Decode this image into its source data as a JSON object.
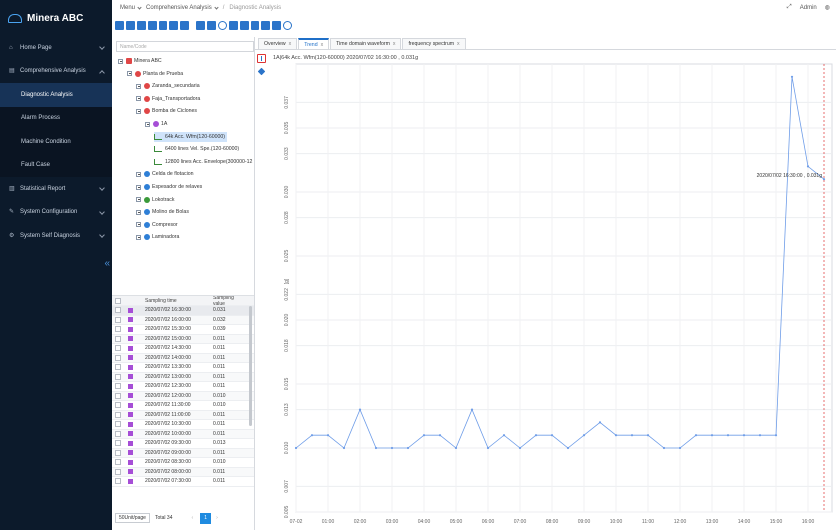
{
  "app": {
    "title": "Minera ABC"
  },
  "sidebar": {
    "items": [
      {
        "label": "Home Page",
        "icon": "home-icon",
        "chevron": "down"
      },
      {
        "label": "Comprehensive Analysis",
        "icon": "chart-icon",
        "chevron": "up"
      },
      {
        "label": "Diagnostic Analysis",
        "sub": true,
        "active": true
      },
      {
        "label": "Alarm Process",
        "sub": true
      },
      {
        "label": "Machine Condition",
        "sub": true
      },
      {
        "label": "Fault Case",
        "sub": true
      },
      {
        "label": "Statistical Report",
        "icon": "report-icon",
        "chevron": "down"
      },
      {
        "label": "System Configuration",
        "icon": "wrench-icon",
        "chevron": "down"
      },
      {
        "label": "System Self Diagnosis",
        "icon": "gear-icon",
        "chevron": "down"
      }
    ],
    "collapse_glyph": "«"
  },
  "topbar": {
    "menu": "Menu",
    "crumb1": "Comprehensive Analysis",
    "crumb2": "Diagnostic Analysis",
    "sep": "/",
    "user": "Admin"
  },
  "tree": {
    "search_placeholder": "Name/Code",
    "nodes": [
      {
        "label": "Minera ABC",
        "level": 0,
        "icon": "company-icon",
        "color": "#e04646"
      },
      {
        "label": "Planta de Prueba",
        "level": 1,
        "icon": "plant-icon",
        "color": "#e04646"
      },
      {
        "label": "Zaranda_secundaria",
        "level": 2,
        "icon": "machine-icon",
        "color": "#e04646"
      },
      {
        "label": "Faja_Transportadora",
        "level": 2,
        "icon": "machine-icon",
        "color": "#e04646"
      },
      {
        "label": "Bomba de Ciclones",
        "level": 2,
        "icon": "machine-icon",
        "color": "#e04646"
      },
      {
        "label": "1A",
        "level": 3,
        "icon": "sensor-icon",
        "color": "#a64ed6"
      },
      {
        "label": "64k Acc. Wfm(120-60000)",
        "level": 4,
        "icon": "waveform-icon",
        "selected": true
      },
      {
        "label": "6400 lines Vel. Spe.(120-60000)",
        "level": 4,
        "icon": "waveform-icon"
      },
      {
        "label": "12800 lines Acc. Envelope(300000-12",
        "level": 4,
        "icon": "waveform-icon"
      },
      {
        "label": "Celda de flotacion",
        "level": 2,
        "icon": "machine-icon",
        "color": "#2e7fd6"
      },
      {
        "label": "Espesador de relaves",
        "level": 2,
        "icon": "machine-icon",
        "color": "#2e7fd6"
      },
      {
        "label": "Lokotrack",
        "level": 2,
        "icon": "machine-icon",
        "color": "#3a9a3a"
      },
      {
        "label": "Molino de Bolas",
        "level": 2,
        "icon": "machine-icon",
        "color": "#2e7fd6"
      },
      {
        "label": "Compresor",
        "level": 2,
        "icon": "machine-icon",
        "color": "#2e7fd6"
      },
      {
        "label": "Laminadora",
        "level": 2,
        "icon": "machine-icon",
        "color": "#2e7fd6"
      }
    ]
  },
  "samples": {
    "col_time": "Sampling time",
    "col_value": "Sampling value",
    "rows": [
      {
        "time": "2020/07/02 16:30:00",
        "value": "0.031"
      },
      {
        "time": "2020/07/02 16:00:00",
        "value": "0.032"
      },
      {
        "time": "2020/07/02 15:30:00",
        "value": "0.039"
      },
      {
        "time": "2020/07/02 15:00:00",
        "value": "0.011"
      },
      {
        "time": "2020/07/02 14:30:00",
        "value": "0.011"
      },
      {
        "time": "2020/07/02 14:00:00",
        "value": "0.011"
      },
      {
        "time": "2020/07/02 13:30:00",
        "value": "0.011"
      },
      {
        "time": "2020/07/02 13:00:00",
        "value": "0.011"
      },
      {
        "time": "2020/07/02 12:30:00",
        "value": "0.011"
      },
      {
        "time": "2020/07/02 12:00:00",
        "value": "0.010"
      },
      {
        "time": "2020/07/02 11:30:00",
        "value": "0.010"
      },
      {
        "time": "2020/07/02 11:00:00",
        "value": "0.011"
      },
      {
        "time": "2020/07/02 10:30:00",
        "value": "0.011"
      },
      {
        "time": "2020/07/02 10:00:00",
        "value": "0.011"
      },
      {
        "time": "2020/07/02 09:30:00",
        "value": "0.013"
      },
      {
        "time": "2020/07/02 09:00:00",
        "value": "0.011"
      },
      {
        "time": "2020/07/02 08:30:00",
        "value": "0.010"
      },
      {
        "time": "2020/07/02 08:00:00",
        "value": "0.011"
      },
      {
        "time": "2020/07/02 07:30:00",
        "value": "0.011"
      }
    ],
    "page_size": "50Unit/page",
    "total": "Total 34",
    "page": "1",
    "prev": "‹",
    "next": "›"
  },
  "tabs": [
    {
      "label": "Overview",
      "close": "x"
    },
    {
      "label": "Trend",
      "close": "x",
      "active": true
    },
    {
      "label": "Time domain waveform",
      "close": "x"
    },
    {
      "label": "frequency spectrum",
      "close": "x"
    }
  ],
  "chart_data": {
    "type": "line",
    "title": "1A|64k Acc. Wfm(120-60000) 2020/07/02 16:30:00 , 0.031g",
    "ylabel": "[g]",
    "ylim": [
      0.005,
      0.04
    ],
    "yticks": [
      0.005,
      0.007,
      0.01,
      0.013,
      0.015,
      0.018,
      0.02,
      0.022,
      0.025,
      0.028,
      0.03,
      0.033,
      0.035,
      0.037
    ],
    "ytick_labels": [
      "0.005",
      "0.007",
      "0.010",
      "0.013",
      "0.015",
      "0.018",
      "0.020",
      "0.022",
      "0.025",
      "0.028",
      "0.030",
      "0.033",
      "0.035",
      "0.037"
    ],
    "x_tick_labels": [
      "07-02",
      "01:00",
      "02:00",
      "03:00",
      "04:00",
      "05:00",
      "06:00",
      "07:00",
      "08:00",
      "09:00",
      "10:00",
      "11:00",
      "12:00",
      "13:00",
      "14:00",
      "15:00",
      "16:00"
    ],
    "x_hours": [
      0,
      0.5,
      1,
      1.5,
      2,
      2.5,
      3,
      3.5,
      4,
      4.5,
      5,
      5.5,
      6,
      6.5,
      7,
      7.5,
      8,
      8.5,
      9,
      9.5,
      10,
      10.5,
      11,
      11.5,
      12,
      12.5,
      13,
      13.5,
      14,
      14.5,
      15,
      15.5,
      16,
      16.5
    ],
    "values": [
      0.01,
      0.011,
      0.011,
      0.01,
      0.013,
      0.01,
      0.01,
      0.01,
      0.011,
      0.011,
      0.01,
      0.013,
      0.01,
      0.011,
      0.01,
      0.011,
      0.011,
      0.01,
      0.011,
      0.012,
      0.011,
      0.011,
      0.011,
      0.01,
      0.01,
      0.011,
      0.011,
      0.011,
      0.011,
      0.011,
      0.011,
      0.039,
      0.032,
      0.031
    ],
    "annotation": "2020/07/02 16:30:00 , 0.031g",
    "line_color": "#6f9de8",
    "marker_color": "#d33",
    "grid": true
  }
}
